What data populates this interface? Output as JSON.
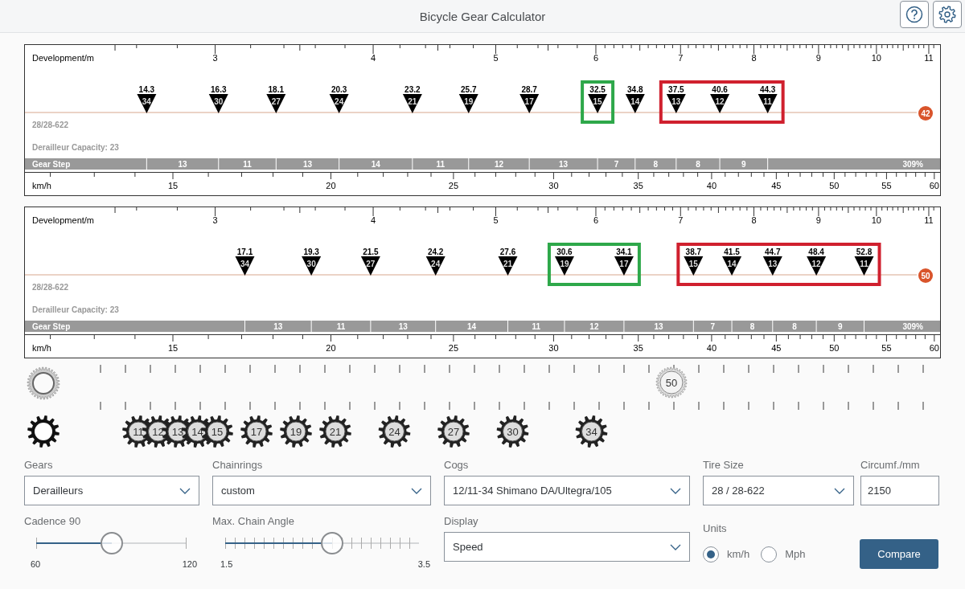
{
  "header": {
    "title": "Bicycle Gear Calculator"
  },
  "panels": [
    {
      "dev_label": "Development/m",
      "dev_ticks": [
        "3",
        "4",
        "5",
        "6",
        "7",
        "8",
        "9",
        "10",
        "11"
      ],
      "markers": [
        {
          "speed": "14.3",
          "cog": "34",
          "kind": "plain"
        },
        {
          "speed": "16.3",
          "cog": "30",
          "kind": "plain"
        },
        {
          "speed": "18.1",
          "cog": "27",
          "kind": "plain"
        },
        {
          "speed": "20.3",
          "cog": "24",
          "kind": "plain"
        },
        {
          "speed": "23.2",
          "cog": "21",
          "kind": "plain"
        },
        {
          "speed": "25.7",
          "cog": "19",
          "kind": "plain"
        },
        {
          "speed": "28.7",
          "cog": "17",
          "kind": "plain"
        },
        {
          "speed": "32.5",
          "cog": "15",
          "kind": "good"
        },
        {
          "speed": "34.8",
          "cog": "14",
          "kind": "plain"
        },
        {
          "speed": "37.5",
          "cog": "13",
          "kind": "bad"
        },
        {
          "speed": "40.6",
          "cog": "12",
          "kind": "bad"
        },
        {
          "speed": "44.3",
          "cog": "11",
          "kind": "bad"
        }
      ],
      "chainring": "42",
      "tire": "28/28-622",
      "capacity": "Derailleur Capacity: 23",
      "step_title": "Gear Step",
      "steps": [
        "13",
        "11",
        "13",
        "14",
        "11",
        "12",
        "13",
        "7",
        "8",
        "8",
        "9"
      ],
      "total": "309%",
      "speed_label": "km/h",
      "speed_ticks": [
        "15",
        "20",
        "25",
        "30",
        "35",
        "40",
        "45",
        "50",
        "55",
        "60"
      ]
    },
    {
      "dev_label": "Development/m",
      "dev_ticks": [
        "3",
        "4",
        "5",
        "6",
        "7",
        "8",
        "9",
        "10",
        "11"
      ],
      "markers": [
        {
          "speed": "17.1",
          "cog": "34",
          "kind": "plain"
        },
        {
          "speed": "19.3",
          "cog": "30",
          "kind": "plain"
        },
        {
          "speed": "21.5",
          "cog": "27",
          "kind": "plain"
        },
        {
          "speed": "24.2",
          "cog": "24",
          "kind": "plain"
        },
        {
          "speed": "27.6",
          "cog": "21",
          "kind": "plain"
        },
        {
          "speed": "30.6",
          "cog": "19",
          "kind": "good"
        },
        {
          "speed": "34.1",
          "cog": "17",
          "kind": "good"
        },
        {
          "speed": "38.7",
          "cog": "15",
          "kind": "bad"
        },
        {
          "speed": "41.5",
          "cog": "14",
          "kind": "bad"
        },
        {
          "speed": "44.7",
          "cog": "13",
          "kind": "bad"
        },
        {
          "speed": "48.4",
          "cog": "12",
          "kind": "bad"
        },
        {
          "speed": "52.8",
          "cog": "11",
          "kind": "bad"
        }
      ],
      "chainring": "50",
      "tire": "28/28-622",
      "capacity": "Derailleur Capacity: 23",
      "step_title": "Gear Step",
      "steps": [
        "13",
        "11",
        "13",
        "14",
        "11",
        "12",
        "13",
        "7",
        "8",
        "8",
        "9"
      ],
      "total": "309%",
      "speed_label": "km/h",
      "speed_ticks": [
        "15",
        "20",
        "25",
        "30",
        "35",
        "40",
        "45",
        "50",
        "55",
        "60"
      ]
    }
  ],
  "drivetrain": {
    "chainrings": [
      "50"
    ],
    "cogs": [
      "11",
      "12",
      "13",
      "14",
      "15",
      "17",
      "19",
      "21",
      "24",
      "27",
      "30",
      "34"
    ]
  },
  "form": {
    "gears": {
      "label": "Gears",
      "value": "Derailleurs"
    },
    "chainrings": {
      "label": "Chainrings",
      "value": "custom"
    },
    "cogs": {
      "label": "Cogs",
      "value": "12/11-34 Shimano DA/Ultegra/105"
    },
    "tire_size": {
      "label": "Tire Size",
      "value": "28 / 28-622"
    },
    "circumference": {
      "label": "Circumf./mm",
      "value": "2150"
    },
    "cadence": {
      "label": "Cadence 90",
      "level": 0.5,
      "min": "60",
      "max": "120"
    },
    "chain_angle": {
      "label": "Max. Chain Angle",
      "level": 0.55,
      "min": "1.5",
      "max": "3.5"
    },
    "display": {
      "label": "Display",
      "value": "Speed"
    },
    "units": {
      "label": "Units",
      "options": [
        {
          "label": "km/h",
          "selected": true
        },
        {
          "label": "Mph",
          "selected": false
        }
      ]
    },
    "compare": "Compare"
  }
}
